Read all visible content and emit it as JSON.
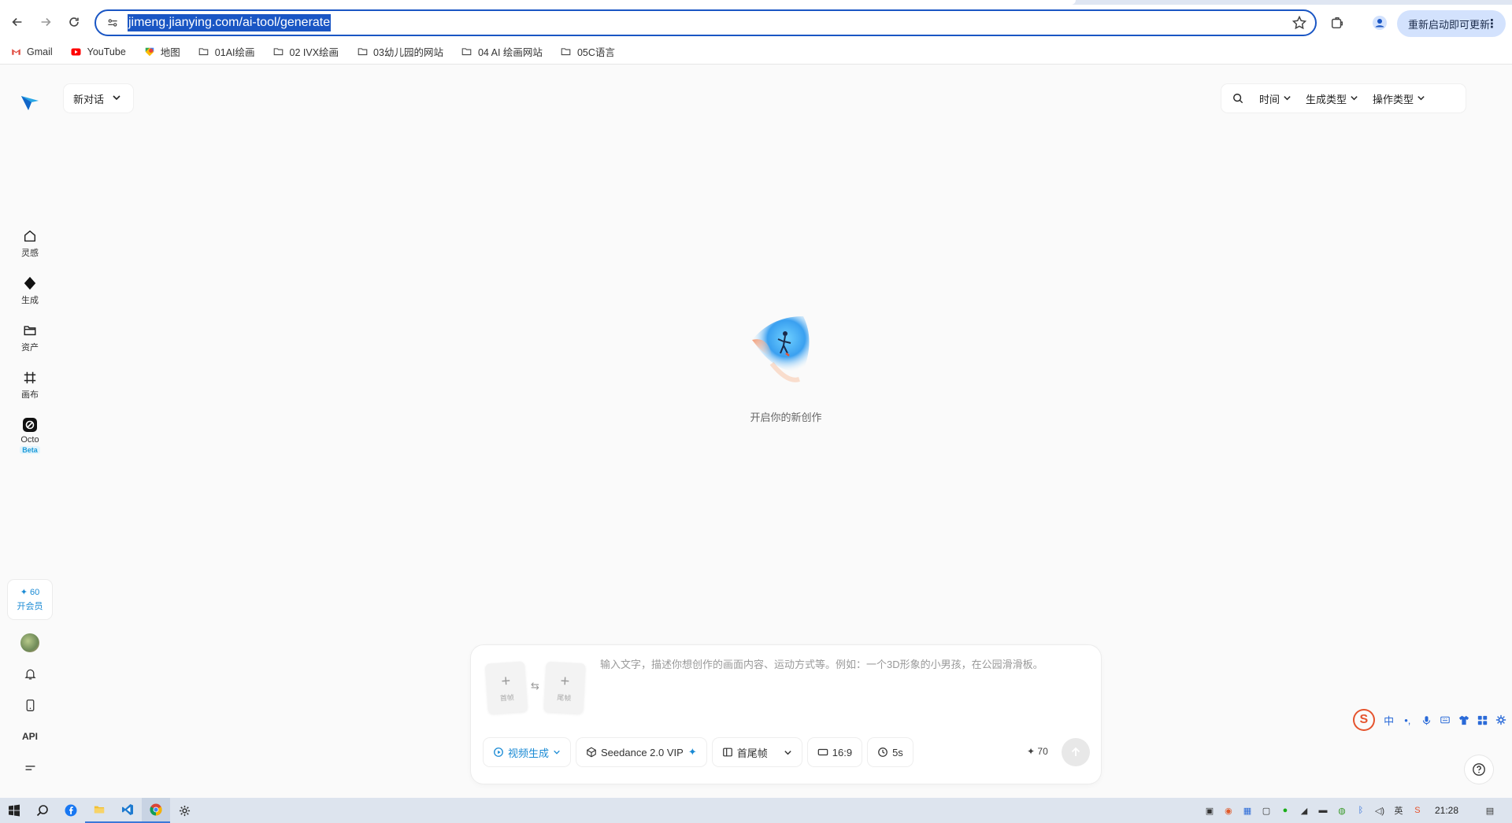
{
  "browser": {
    "url": "jimeng.jianying.com/ai-tool/generate",
    "update_button": "重新启动即可更新",
    "bookmarks": [
      {
        "label": "Gmail",
        "icon": "gmail-icon"
      },
      {
        "label": "YouTube",
        "icon": "youtube-icon"
      },
      {
        "label": "地图",
        "icon": "maps-icon"
      },
      {
        "label": "01AI绘画",
        "icon": "folder-icon"
      },
      {
        "label": "02 IVX绘画",
        "icon": "folder-icon"
      },
      {
        "label": "03幼儿园的网站",
        "icon": "folder-icon"
      },
      {
        "label": "04 AI 绘画网站",
        "icon": "folder-icon"
      },
      {
        "label": "05C语言",
        "icon": "folder-icon"
      }
    ]
  },
  "app": {
    "new_chat": "新对话",
    "filters": [
      "时间",
      "生成类型",
      "操作类型"
    ],
    "sidebar": [
      {
        "label": "灵感",
        "icon": "home-icon"
      },
      {
        "label": "生成",
        "icon": "diamond-icon"
      },
      {
        "label": "资产",
        "icon": "folder-icon"
      },
      {
        "label": "画布",
        "icon": "canvas-icon"
      },
      {
        "label": "Octo",
        "icon": "octo-icon",
        "badge": "Beta"
      }
    ],
    "vip": {
      "credits": "60",
      "label": "开会员"
    },
    "api_label": "API",
    "hero_text": "开启你的新创作",
    "composer": {
      "first_frame": "首帧",
      "last_frame": "尾帧",
      "placeholder": "输入文字，描述你想创作的画面内容、运动方式等。例如：一个3D形象的小男孩，在公园滑滑板。",
      "mode": "视频生成",
      "model": "Seedance 2.0 VIP",
      "frame_mode": "首尾帧",
      "ratio": "16:9",
      "duration": "5s",
      "credits": "70"
    }
  },
  "ime": {
    "lang": "中"
  },
  "taskbar": {
    "time": "21:28"
  },
  "colors": {
    "accent": "#1a56c4",
    "brand_blue": "#1a8ad4"
  }
}
